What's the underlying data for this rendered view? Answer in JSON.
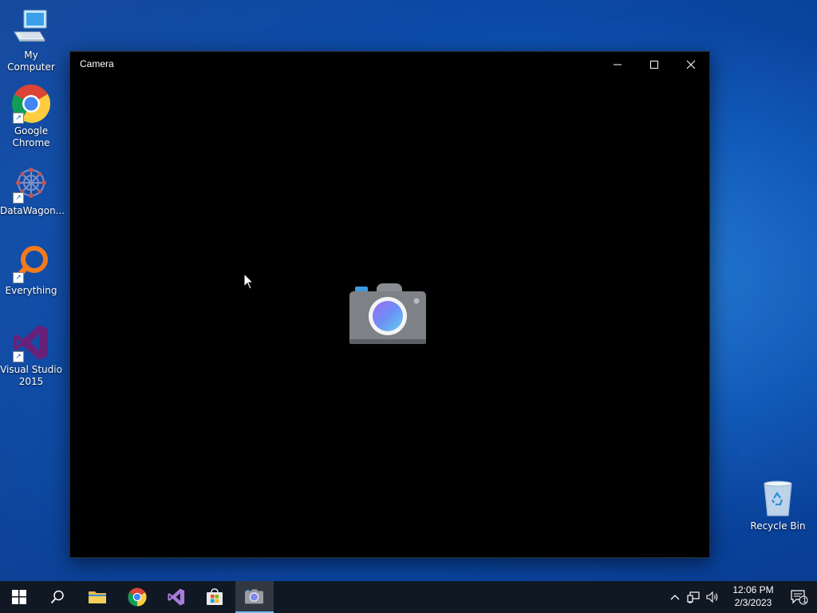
{
  "desktop": {
    "icons": [
      {
        "label": "My Computer",
        "icon": "computer-icon"
      },
      {
        "label": "Google Chrome",
        "icon": "chrome-icon"
      },
      {
        "label": "DataWagon...",
        "icon": "datawagon-icon"
      },
      {
        "label": "Everything",
        "icon": "everything-icon"
      },
      {
        "label": "Visual Studio 2015",
        "icon": "visual-studio-icon"
      },
      {
        "label": "Recycle Bin",
        "icon": "recycle-bin-icon"
      }
    ]
  },
  "window": {
    "title": "Camera",
    "background": "#000000",
    "controls": {
      "minimize": "minimize-icon",
      "maximize": "maximize-icon",
      "close": "close-icon"
    },
    "placeholder_icon": "camera-icon"
  },
  "taskbar": {
    "buttons": [
      {
        "name": "start-button",
        "icon": "windows-logo-icon"
      },
      {
        "name": "search-button",
        "icon": "search-icon"
      },
      {
        "name": "file-explorer-button",
        "icon": "folder-icon"
      },
      {
        "name": "chrome-taskbar-button",
        "icon": "chrome-icon"
      },
      {
        "name": "visual-studio-taskbar-button",
        "icon": "visual-studio-icon"
      },
      {
        "name": "store-taskbar-button",
        "icon": "store-icon"
      },
      {
        "name": "camera-taskbar-button",
        "icon": "camera-icon",
        "active": true
      }
    ],
    "tray": {
      "show_hidden": "chevron-up-icon",
      "network": "network-icon",
      "volume": "volume-icon",
      "time": "12:06 PM",
      "date": "2/3/2023",
      "notifications_count": "1"
    }
  },
  "colors": {
    "taskbar": "#101824",
    "accent": "#76b9ed",
    "desktop": "#1565c8"
  }
}
